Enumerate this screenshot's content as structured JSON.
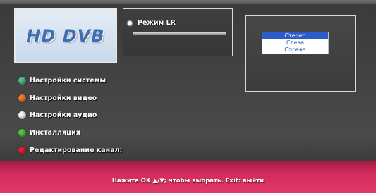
{
  "logo": {
    "text": "HD DVB"
  },
  "menu": {
    "items": [
      {
        "label": "Настройки системы",
        "icon": "green-dot-icon",
        "color": "#4fbf83"
      },
      {
        "label": "Настройки видео",
        "icon": "orange-dot-icon",
        "color": "#f07a2a"
      },
      {
        "label": "Настройки аудио",
        "icon": "white-dot-icon",
        "color": "#f4f4f4"
      },
      {
        "label": "Инсталляция",
        "icon": "green-dot-icon",
        "color": "#56c43c"
      },
      {
        "label": "Редактирование канал:",
        "icon": "red-dot-icon",
        "color": "#e0203a"
      }
    ]
  },
  "lr_mode": {
    "label": "Режим LR",
    "icon": "radio-icon"
  },
  "options": {
    "items": [
      "Стерео",
      "Слева",
      "Справа"
    ],
    "selected_index": 0
  },
  "footer": {
    "hint": "Нажите OK ▲/▼; чтобы выбрать. Exit: выйти"
  },
  "colors": {
    "footer_bg": "#d22c5c",
    "selection": "#2b5cc8"
  }
}
